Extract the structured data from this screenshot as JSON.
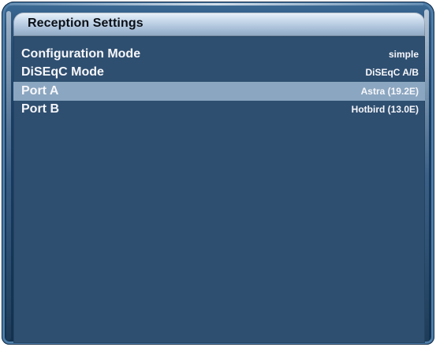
{
  "window": {
    "title": "Reception Settings"
  },
  "settings": {
    "items": [
      {
        "label": "Configuration Mode",
        "value": "simple",
        "selected": false
      },
      {
        "label": "DiSEqC Mode",
        "value": "DiSEqC A/B",
        "selected": false
      },
      {
        "label": "Port A",
        "value": "Astra (19.2E)",
        "selected": true
      },
      {
        "label": "Port B",
        "value": "Hotbird (13.0E)",
        "selected": false
      }
    ]
  },
  "colors": {
    "frame_blue": "#183d62",
    "panel_blue": "#2f4f70",
    "selected_row": "#8ba6c0",
    "title_text": "#0a0f16",
    "text": "#f6f7fb"
  }
}
